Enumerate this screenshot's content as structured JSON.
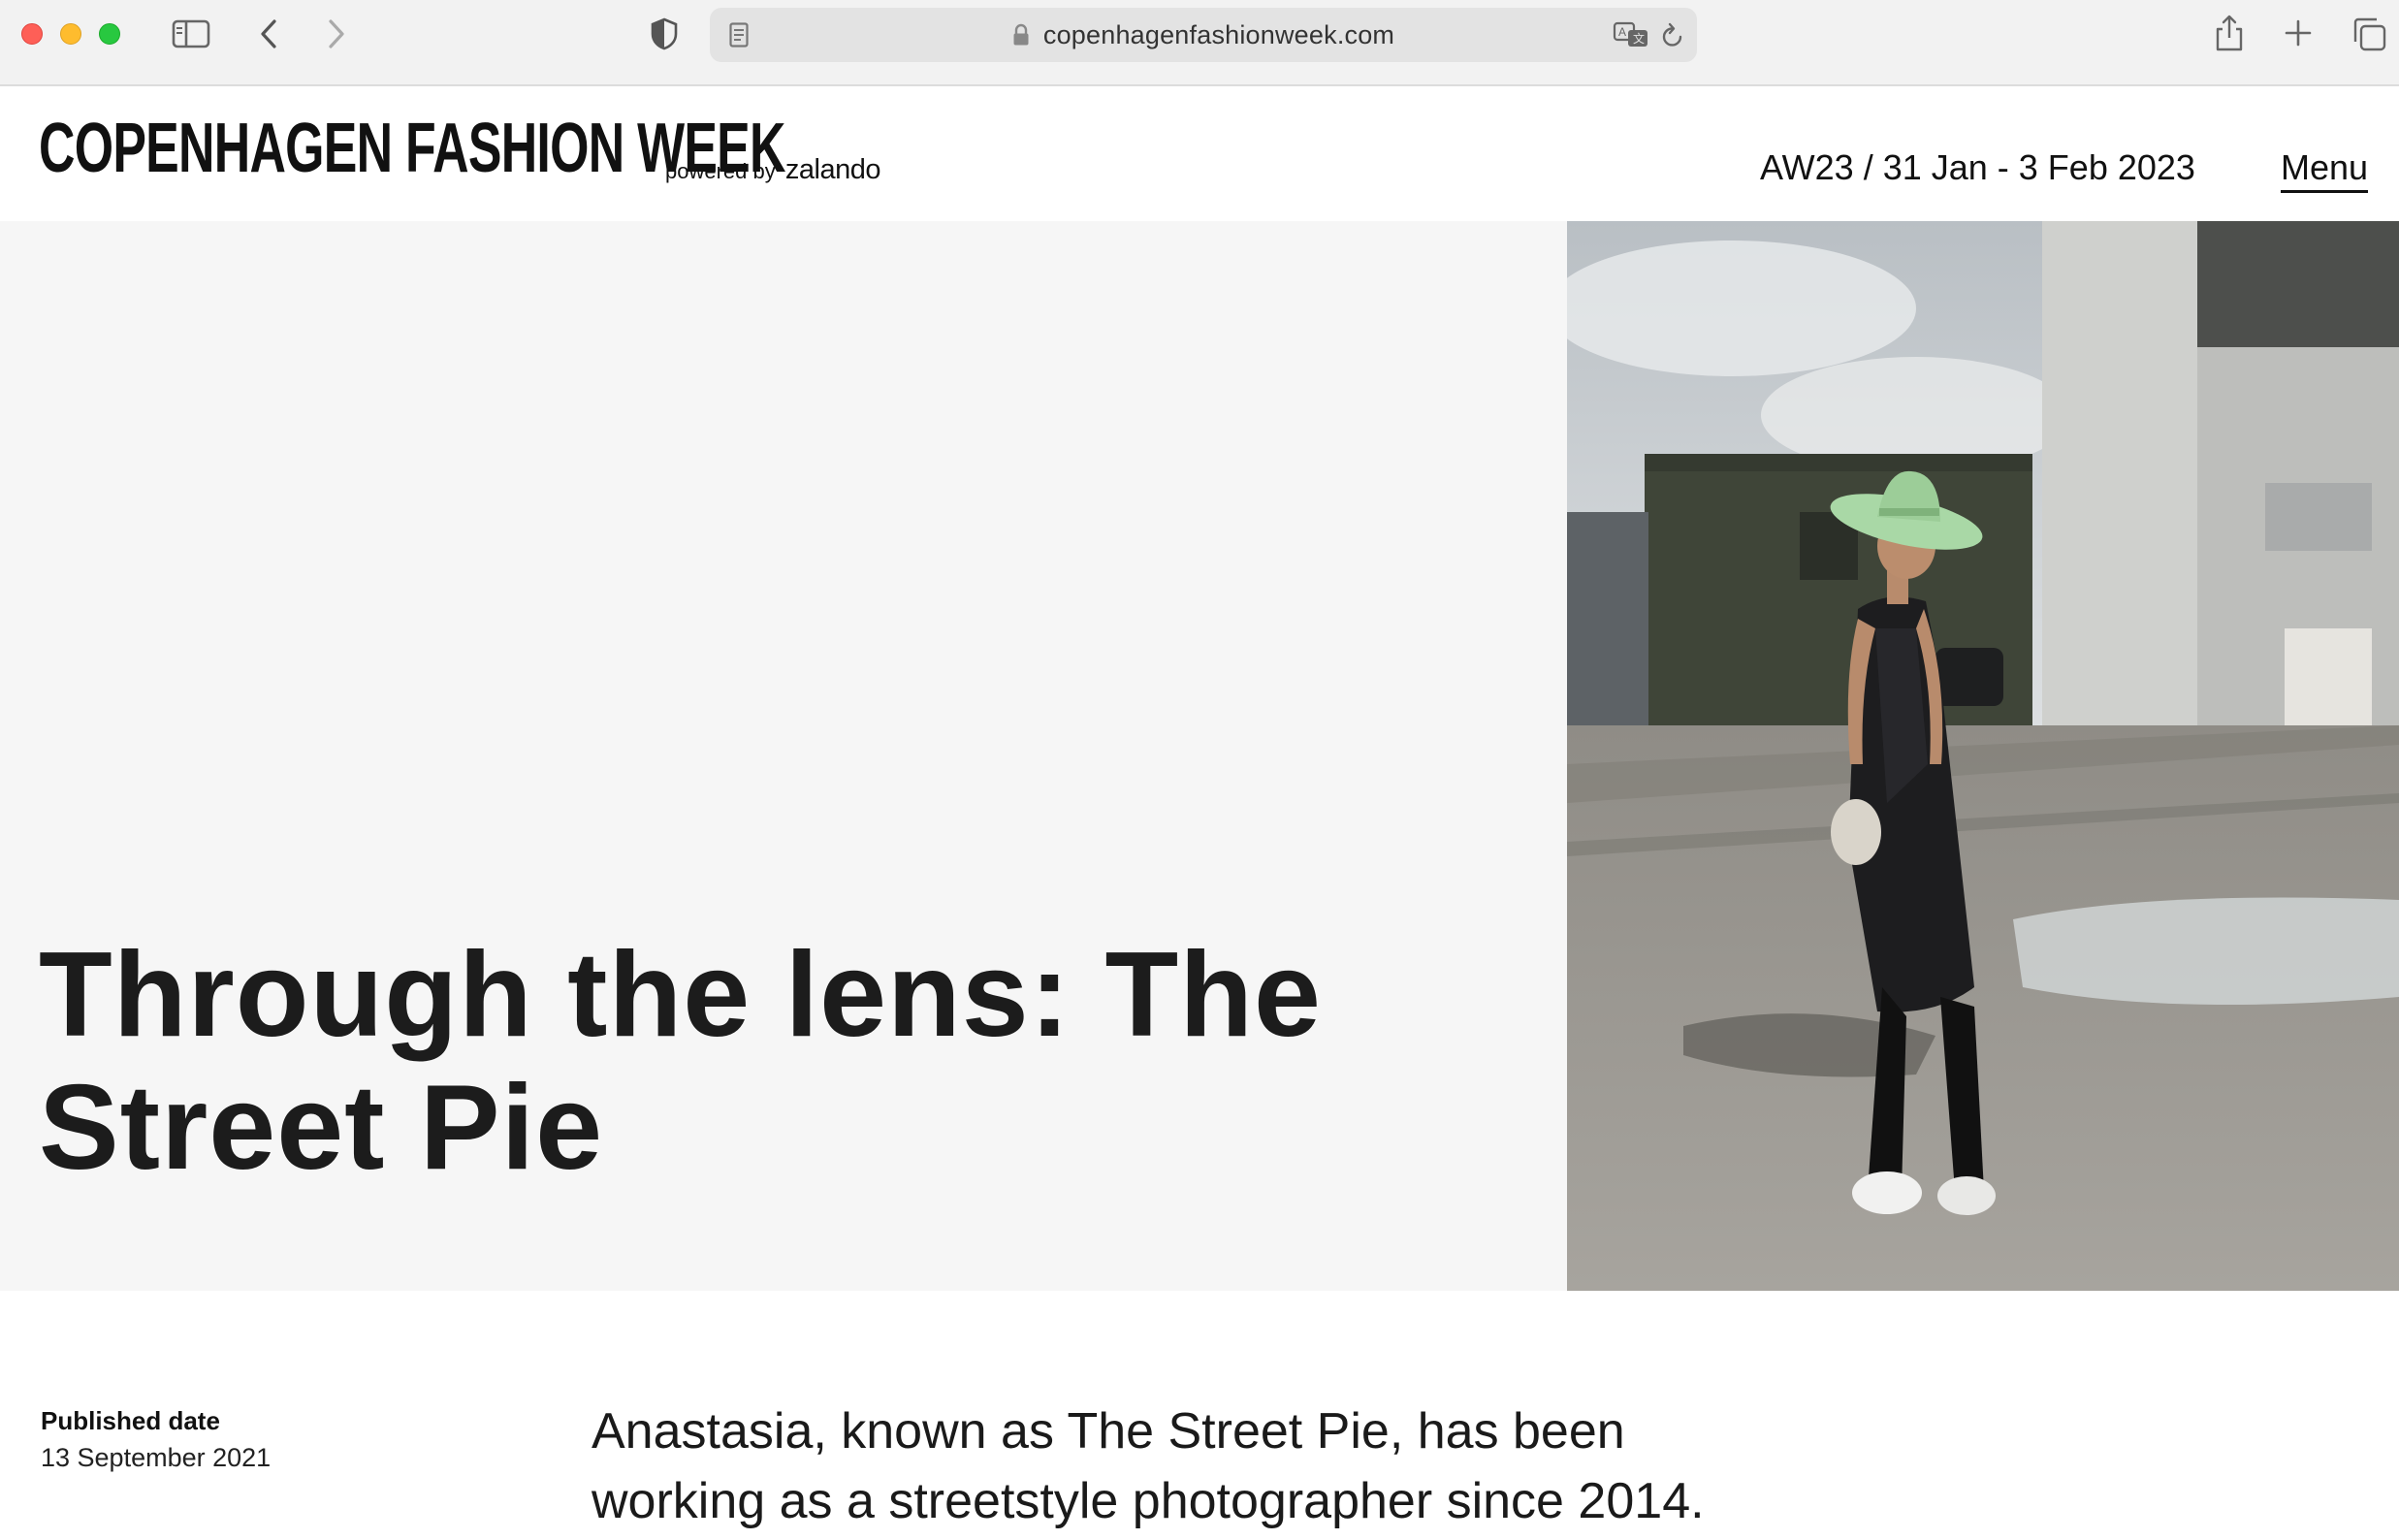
{
  "browser": {
    "url": "copenhagenfashionweek.com",
    "icons": [
      "sidebar-icon",
      "back-icon",
      "forward-icon",
      "shield-icon",
      "reader-icon",
      "lock-icon",
      "translate-icon",
      "reload-icon",
      "share-icon",
      "new-tab-icon",
      "tabs-overview-icon"
    ]
  },
  "header": {
    "brand": "COPENHAGEN FASHION WEEK",
    "powered_by": "powered by",
    "partner": "zalando",
    "season": "AW23 / 31 Jan - 3 Feb 2023",
    "menu_label": "Menu"
  },
  "hero": {
    "title_line1": "Through the lens: The",
    "title_line2": "Street Pie"
  },
  "article": {
    "published_label": "Published date",
    "published_date": "13 September 2021",
    "intro_line1": "Anastasia, known as The Street Pie, has been",
    "intro_line2": "working as a streetstyle photographer since 2014."
  },
  "colors": {
    "hero_background": "#f6f6f6",
    "text": "#1a1a1a",
    "hat_green": "#a9d8a6"
  }
}
